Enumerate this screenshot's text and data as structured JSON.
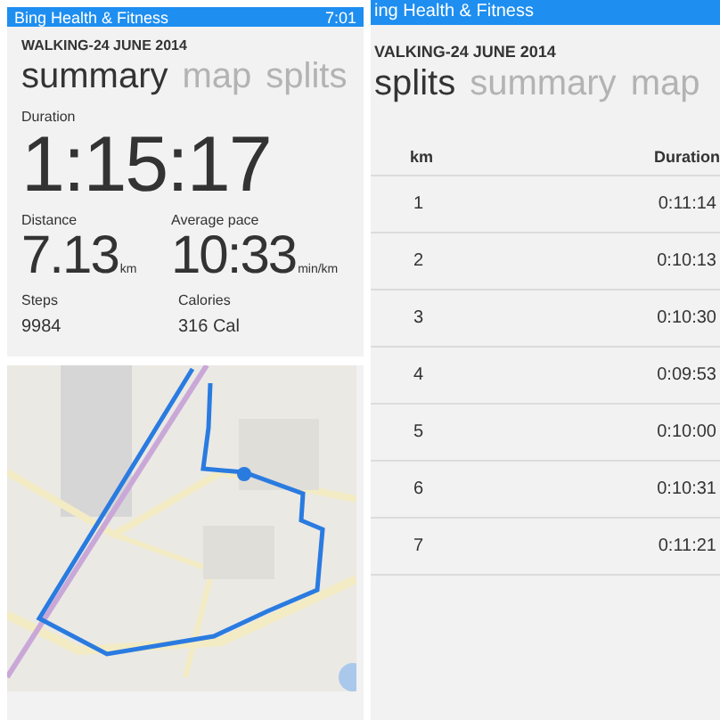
{
  "left_screen": {
    "status_bar": {
      "app": "Bing Health & Fitness",
      "time": "7:01"
    },
    "activity_title": "WALKING-24 JUNE 2014",
    "pivots": [
      {
        "label": "summary",
        "selected": true
      },
      {
        "label": "map",
        "selected": false
      },
      {
        "label": "splits",
        "selected": false
      }
    ],
    "duration": {
      "label": "Duration",
      "value": "1:15:17"
    },
    "stats": [
      {
        "label": "Distance",
        "value": "7.13",
        "unit": "km"
      },
      {
        "label": "Average pace",
        "value": "10:33",
        "unit": "min/km"
      }
    ],
    "counts": [
      {
        "label": "Steps",
        "value": "9984"
      },
      {
        "label": "Calories",
        "value": "316 Cal"
      }
    ]
  },
  "right_screen": {
    "status_bar": {
      "app": "ing Health & Fitness"
    },
    "activity_title": "VALKING-24 JUNE 2014",
    "pivots": [
      {
        "label": "splits",
        "selected": true
      },
      {
        "label": "summary",
        "selected": false
      },
      {
        "label": "map",
        "selected": false
      }
    ],
    "table": {
      "columns": [
        "km",
        "Duration"
      ],
      "rows": [
        [
          "1",
          "0:11:14"
        ],
        [
          "2",
          "0:10:13"
        ],
        [
          "3",
          "0:10:30"
        ],
        [
          "4",
          "0:09:53"
        ],
        [
          "5",
          "0:10:00"
        ],
        [
          "6",
          "0:10:31"
        ],
        [
          "7",
          "0:11:21"
        ]
      ]
    }
  }
}
